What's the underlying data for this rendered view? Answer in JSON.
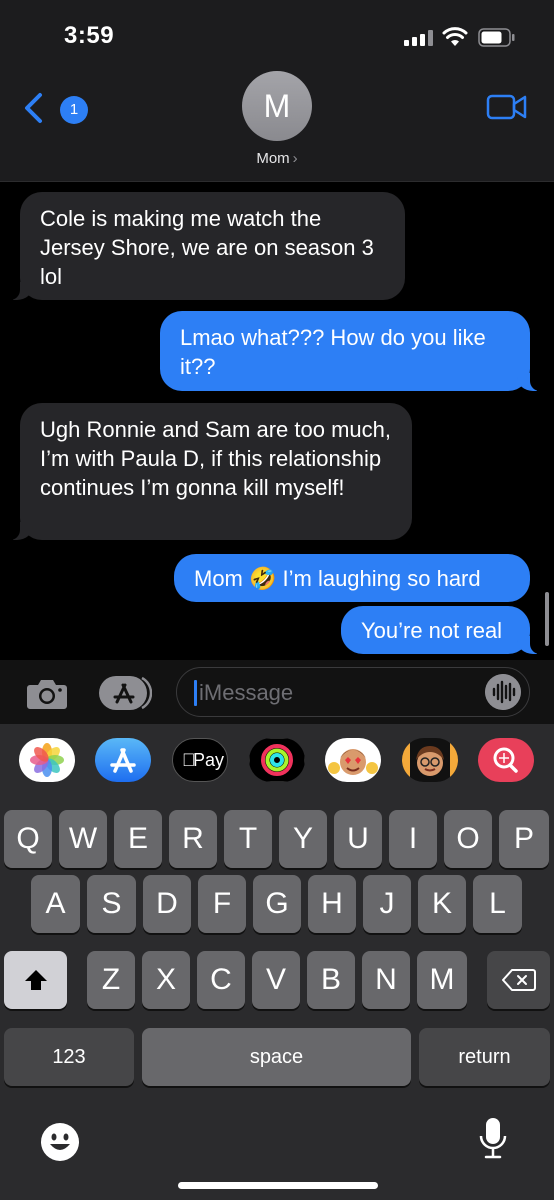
{
  "status_bar": {
    "time": "3:59"
  },
  "header": {
    "back_badge": "1",
    "avatar_initial": "M",
    "contact_name": "Mom",
    "contact_chevron": "›"
  },
  "messages": [
    {
      "direction": "incoming",
      "text": "Cole is making me watch the Jersey Shore, we are on season 3 lol"
    },
    {
      "direction": "outgoing",
      "text": "Lmao what??? How do you like it??"
    },
    {
      "direction": "incoming",
      "text": "Ugh Ronnie and Sam are too much, I’m with Paula D, if this relationship continues I’m gonna kill myself!"
    },
    {
      "direction": "outgoing",
      "text": "Mom 🤣 I’m laughing so hard"
    },
    {
      "direction": "outgoing",
      "text": "You’re not real"
    }
  ],
  "compose": {
    "placeholder": "iMessage"
  },
  "app_drawer": {
    "items": [
      "photos-icon",
      "app-store-icon",
      "apple-pay-icon",
      "activity-icon",
      "memoji-stickers-icon",
      "memoji-icon",
      "search-images-icon"
    ],
    "apple_pay_label": "Pay"
  },
  "keyboard": {
    "row1": [
      "Q",
      "W",
      "E",
      "R",
      "T",
      "Y",
      "U",
      "I",
      "O",
      "P"
    ],
    "row2": [
      "A",
      "S",
      "D",
      "F",
      "G",
      "H",
      "J",
      "K",
      "L"
    ],
    "row3": [
      "Z",
      "X",
      "C",
      "V",
      "B",
      "N",
      "M"
    ],
    "numbers_label": "123",
    "space_label": "space",
    "return_label": "return"
  },
  "colors": {
    "outgoing": "#2d7ff5",
    "incoming": "#262629",
    "background": "#000000"
  }
}
